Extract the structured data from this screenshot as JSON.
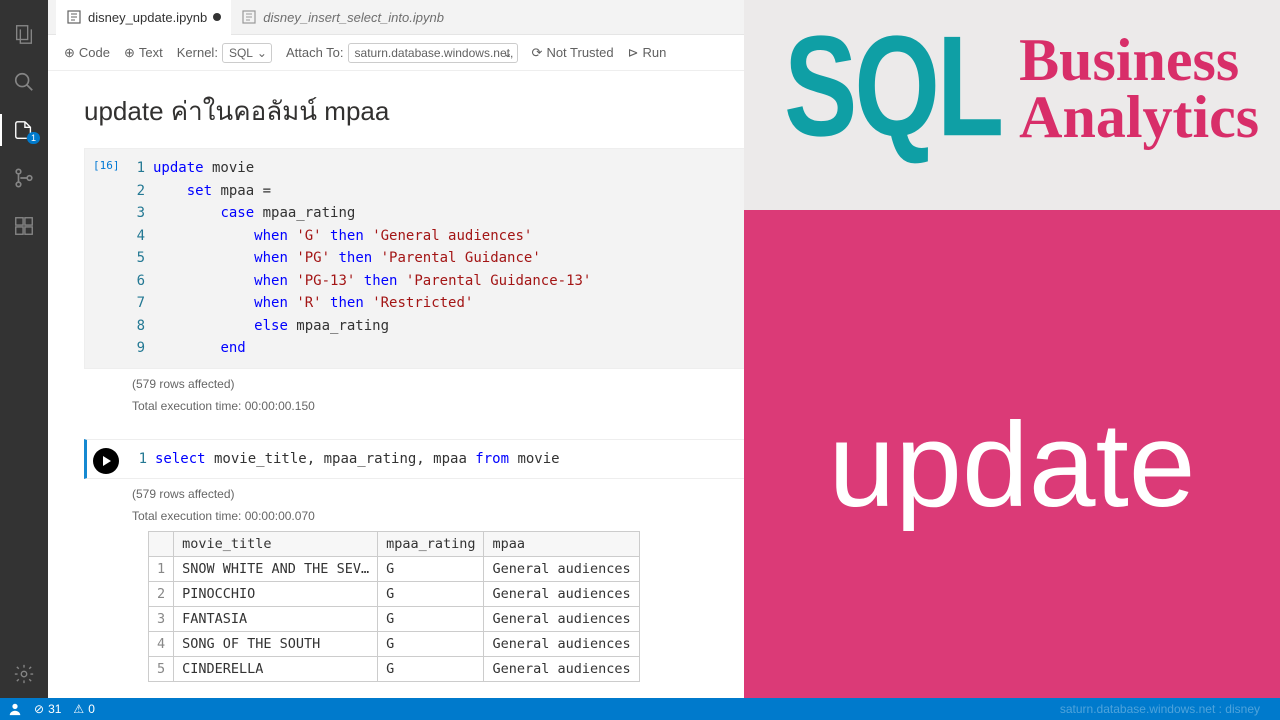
{
  "tabs": [
    {
      "label": "disney_update.ipynb",
      "active": true,
      "dirty": true
    },
    {
      "label": "disney_insert_select_into.ipynb",
      "active": false,
      "dirty": false
    }
  ],
  "toolbar": {
    "code": "Code",
    "text": "Text",
    "kernel_label": "Kernel:",
    "kernel_value": "SQL",
    "attach_label": "Attach To:",
    "attach_value": "saturn.database.windows.net, (",
    "trust": "Not Trusted",
    "run": "Run"
  },
  "heading": "update ค่าในคอลัมน์ mpaa",
  "cell1": {
    "exec": "[16]",
    "lines": [
      {
        "n": 1,
        "tokens": [
          {
            "t": "update",
            "c": "kw"
          },
          {
            "t": " movie"
          }
        ]
      },
      {
        "n": 2,
        "tokens": [
          {
            "t": "    "
          },
          {
            "t": "set",
            "c": "kw"
          },
          {
            "t": " mpaa ="
          }
        ]
      },
      {
        "n": 3,
        "tokens": [
          {
            "t": "        "
          },
          {
            "t": "case",
            "c": "kw"
          },
          {
            "t": " mpaa_rating"
          }
        ]
      },
      {
        "n": 4,
        "tokens": [
          {
            "t": "            "
          },
          {
            "t": "when",
            "c": "kw"
          },
          {
            "t": " "
          },
          {
            "t": "'G'",
            "c": "str"
          },
          {
            "t": " "
          },
          {
            "t": "then",
            "c": "kw"
          },
          {
            "t": " "
          },
          {
            "t": "'General audiences'",
            "c": "str"
          }
        ]
      },
      {
        "n": 5,
        "tokens": [
          {
            "t": "            "
          },
          {
            "t": "when",
            "c": "kw"
          },
          {
            "t": " "
          },
          {
            "t": "'PG'",
            "c": "str"
          },
          {
            "t": " "
          },
          {
            "t": "then",
            "c": "kw"
          },
          {
            "t": " "
          },
          {
            "t": "'Parental Guidance'",
            "c": "str"
          }
        ]
      },
      {
        "n": 6,
        "tokens": [
          {
            "t": "            "
          },
          {
            "t": "when",
            "c": "kw"
          },
          {
            "t": " "
          },
          {
            "t": "'PG-13'",
            "c": "str"
          },
          {
            "t": " "
          },
          {
            "t": "then",
            "c": "kw"
          },
          {
            "t": " "
          },
          {
            "t": "'Parental Guidance-13'",
            "c": "str"
          }
        ]
      },
      {
        "n": 7,
        "tokens": [
          {
            "t": "            "
          },
          {
            "t": "when",
            "c": "kw"
          },
          {
            "t": " "
          },
          {
            "t": "'R'",
            "c": "str"
          },
          {
            "t": " "
          },
          {
            "t": "then",
            "c": "kw"
          },
          {
            "t": " "
          },
          {
            "t": "'Restricted'",
            "c": "str"
          }
        ]
      },
      {
        "n": 8,
        "tokens": [
          {
            "t": "            "
          },
          {
            "t": "else",
            "c": "kw"
          },
          {
            "t": " mpaa_rating"
          }
        ]
      },
      {
        "n": 9,
        "tokens": [
          {
            "t": "        "
          },
          {
            "t": "end",
            "c": "kw"
          }
        ]
      }
    ],
    "rows_affected": "(579 rows affected)",
    "exec_time": "Total execution time: 00:00:00.150"
  },
  "cell2": {
    "lines": [
      {
        "n": 1,
        "tokens": [
          {
            "t": "select",
            "c": "kw"
          },
          {
            "t": " movie_title, mpaa_rating, mpaa "
          },
          {
            "t": "from",
            "c": "kw"
          },
          {
            "t": " movie"
          }
        ]
      }
    ],
    "rows_affected": "(579 rows affected)",
    "exec_time": "Total execution time: 00:00:00.070"
  },
  "table": {
    "columns": [
      "movie_title",
      "mpaa_rating",
      "mpaa"
    ],
    "rows": [
      [
        "1",
        "SNOW WHITE AND THE SEV…",
        "G",
        "General audiences"
      ],
      [
        "2",
        "PINOCCHIO",
        "G",
        "General audiences"
      ],
      [
        "3",
        "FANTASIA",
        "G",
        "General audiences"
      ],
      [
        "4",
        "SONG OF THE SOUTH",
        "G",
        "General audiences"
      ],
      [
        "5",
        "CINDERELLA",
        "G",
        "General audiences"
      ]
    ]
  },
  "overlay": {
    "sql": "SQL",
    "l1": "Business",
    "l2": "Analytics",
    "big": "update"
  },
  "status": {
    "errors": "31",
    "warnings": "0",
    "conn": "saturn.database.windows.net : disney"
  }
}
